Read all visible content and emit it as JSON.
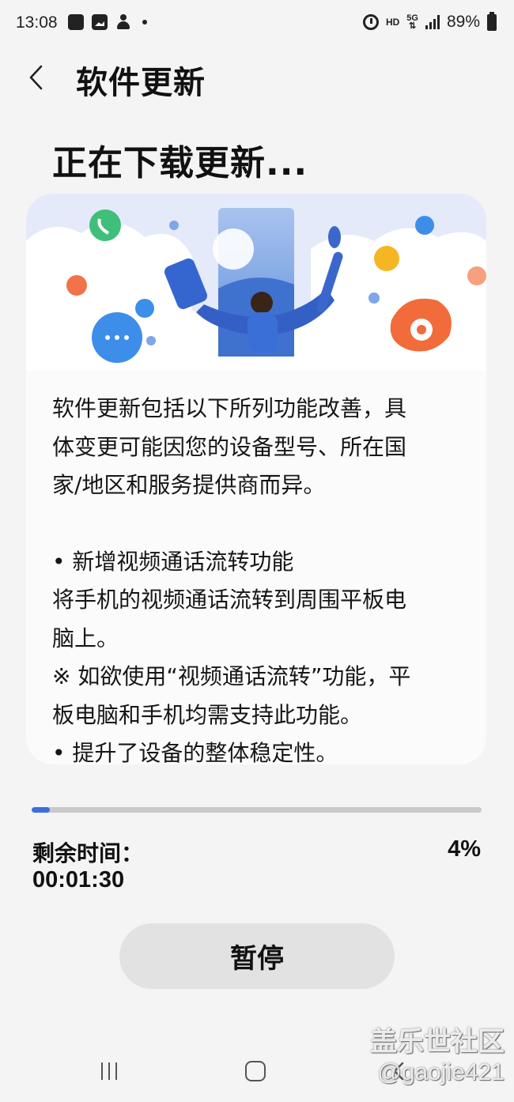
{
  "status_bar": {
    "time": "13:08",
    "hd": "HD",
    "network": "5G",
    "battery": "89%",
    "left_icons": [
      "phone-signal-icon",
      "gallery-icon",
      "accessibility-icon"
    ],
    "right_icons": [
      "alarm-icon",
      "hd-icon",
      "5g-icon",
      "signal-icon",
      "battery-icon"
    ]
  },
  "header": {
    "title": "软件更新",
    "back_icon": "chevron-left-icon"
  },
  "heading": "正在下载更新...",
  "card": {
    "intro": "软件更新包括以下所列功能改善，具\n体变更可能因您的设备型号、所在国\n家/地区和服务提供商而异。",
    "feature_1": "• 新增视频通话流转功能\n将手机的视频通话流转到周围平板电\n脑上。\n※ 如欲使用“视频通话流转”功能，平\n板电脑和手机均需支持此功能。",
    "feature_2": "• 提升了设备的整体稳定性。"
  },
  "progress": {
    "fraction": 0.04,
    "remaining_label": "剩余时间：",
    "remaining_time": "00:01:30",
    "percent": "4%",
    "fill_color": "#3a6fe0"
  },
  "pause_button": "暂停",
  "nav": {
    "icons": [
      "recent-apps-icon",
      "home-icon",
      "back-icon"
    ]
  },
  "watermark": {
    "line1": "盖乐世社区",
    "line2": "@gaojie421"
  }
}
